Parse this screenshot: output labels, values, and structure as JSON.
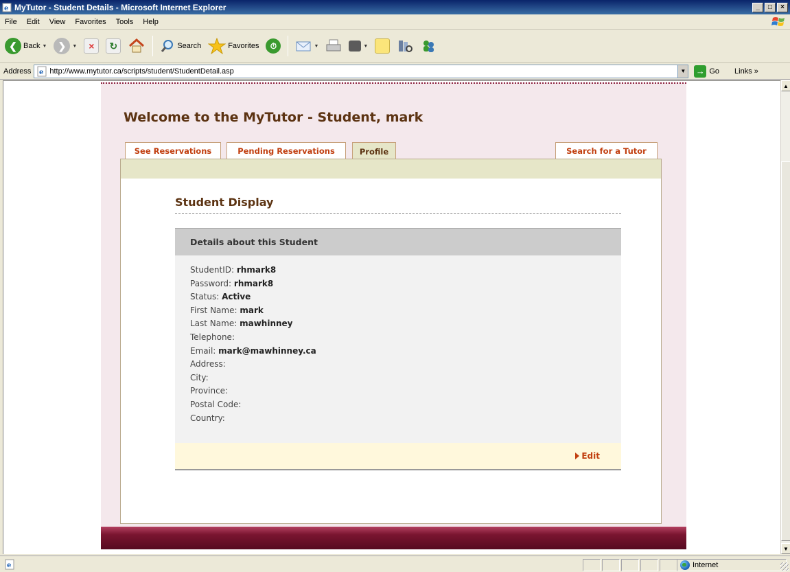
{
  "window": {
    "title": "MyTutor - Student Details - Microsoft Internet Explorer",
    "controls": [
      "_",
      "□",
      "×"
    ]
  },
  "menubar": {
    "items": [
      "File",
      "Edit",
      "View",
      "Favorites",
      "Tools",
      "Help"
    ]
  },
  "toolbar": {
    "back_label": "Back",
    "search_label": "Search",
    "favorites_label": "Favorites"
  },
  "addressbar": {
    "label": "Address",
    "url": "http://www.mytutor.ca/scripts/student/StudentDetail.asp",
    "go_label": "Go",
    "links_label": "Links »"
  },
  "page": {
    "welcome": "Welcome to the MyTutor - Student, mark",
    "tabs": {
      "see_reservations": "See Reservations",
      "pending_reservations": "Pending Reservations",
      "profile": "Profile",
      "search_tutor": "Search for a Tutor"
    },
    "section_title": "Student Display",
    "panel_heading": "Details about this Student",
    "details": [
      {
        "label": "StudentID:",
        "value": "rhmark8"
      },
      {
        "label": "Password:",
        "value": "rhmark8"
      },
      {
        "label": "Status:",
        "value": "Active"
      },
      {
        "label": "First Name:",
        "value": "mark"
      },
      {
        "label": "Last Name:",
        "value": "mawhinney"
      },
      {
        "label": "Telephone:",
        "value": ""
      },
      {
        "label": "Email:",
        "value": "mark@mawhinney.ca"
      },
      {
        "label": "Address:",
        "value": ""
      },
      {
        "label": "City:",
        "value": ""
      },
      {
        "label": "Province:",
        "value": ""
      },
      {
        "label": "Postal Code:",
        "value": ""
      },
      {
        "label": "Country:",
        "value": ""
      }
    ],
    "edit_label": "Edit"
  },
  "statusbar": {
    "zone_label": "Internet"
  },
  "colors": {
    "brand_brown": "#5c3312",
    "link_orange": "#c13e0f",
    "page_pink": "#f4e8ec",
    "footer_maroon": "#7a1530",
    "stripe_khaki": "#e6e6c8"
  }
}
